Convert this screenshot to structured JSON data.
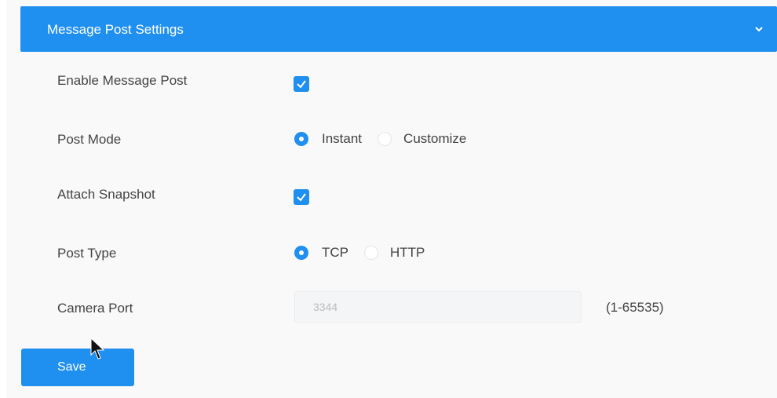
{
  "header": {
    "title": "Message Post Settings",
    "collapse_icon": "chevron-down-icon"
  },
  "rows": {
    "enable_message_post": {
      "label": "Enable Message Post",
      "checked": true
    },
    "post_mode": {
      "label": "Post Mode",
      "options": [
        "Instant",
        "Customize"
      ],
      "selected": "Instant"
    },
    "attach_snapshot": {
      "label": "Attach Snapshot",
      "checked": true
    },
    "post_type": {
      "label": "Post Type",
      "options": [
        "TCP",
        "HTTP"
      ],
      "selected": "TCP"
    },
    "camera_port": {
      "label": "Camera Port",
      "value": "3344",
      "range": "(1-65535)"
    }
  },
  "actions": {
    "save_label": "Save"
  },
  "colors": {
    "accent": "#1f8ff0",
    "panel_bg": "#f9f9f9"
  }
}
